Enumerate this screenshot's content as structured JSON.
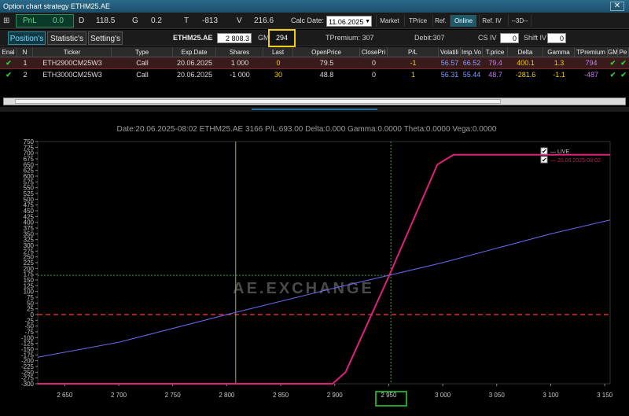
{
  "window": {
    "title": "Option chart strategy ETHM25.AE",
    "close_icon": "close-icon"
  },
  "stats": {
    "pnl_label": "PnL",
    "pnl_value": "0.0",
    "d_label": "D",
    "d_value": "118.5",
    "g_label": "G",
    "g_value": "0.2",
    "t_label": "T",
    "t_value": "-813",
    "v_label": "V",
    "v_value": "216.6"
  },
  "calc": {
    "label": "Calc Date:",
    "value": "11.06.2025"
  },
  "toolbar": {
    "market": "Market",
    "tprice": "TPrice",
    "ref": "Ref.",
    "online": "Online",
    "refiv": "Ref. IV",
    "view3d": "--3D--"
  },
  "tabs": [
    {
      "label": "Position's"
    },
    {
      "label": "Statistic's"
    },
    {
      "label": "Setting's"
    }
  ],
  "underlying": {
    "symbol": "ETHM25.AE",
    "price": "2 808.3",
    "gm_label": "GM",
    "gm_value": "294",
    "tpremium": "TPremium: 307",
    "debit": "Debit:307",
    "csiv_label": "CS IV",
    "csiv_value": "0",
    "shiftiv_label": "Shift IV",
    "shiftiv_value": "0"
  },
  "table": {
    "headers": [
      "Enal",
      "N",
      "Ticker",
      "Type",
      "Exp.Date",
      "Shares",
      "Last",
      "OpenPrice",
      "ClosePri",
      "P/L",
      "Volatili",
      "Imp.Vo",
      "T.price",
      "Delta",
      "Gamma",
      "TPremium",
      "GM",
      "Pe"
    ],
    "rows": [
      {
        "n": "1",
        "ticker": "ETH2900CM25W3",
        "type": "Call",
        "exp": "20.06.2025",
        "shares": "1 000",
        "last": "0",
        "open": "79.5",
        "close": "0",
        "pl": "-1",
        "vol": "56.57",
        "imp": "66.52",
        "tprice": "79.4",
        "delta": "400.1",
        "gamma": "1.3",
        "tpremium": "794"
      },
      {
        "n": "2",
        "ticker": "ETH3000CM25W3",
        "type": "Call",
        "exp": "20.06.2025",
        "shares": "-1 000",
        "last": "30",
        "open": "48.8",
        "close": "0",
        "pl": "1",
        "vol": "56.31",
        "imp": "55.44",
        "tprice": "48.7",
        "delta": "-281.6",
        "gamma": "-1.1",
        "tpremium": "-487"
      }
    ]
  },
  "chart_info": "Date:20.06.2025-08:02  ETHM25.AE 3166  P/L:693.00  Delta:0.000  Gamma:0.0000  Theta:0.0000  Vega:0.0000",
  "watermark": "AE.EXCHANGE",
  "chart_data": {
    "type": "line",
    "ylim": [
      -300,
      750
    ],
    "xlim": [
      2625,
      3155
    ],
    "y_ticks": [
      -300,
      -275,
      -250,
      -225,
      -200,
      -175,
      -150,
      -125,
      -100,
      -75,
      -50,
      -25,
      0,
      25,
      50,
      75,
      100,
      125,
      150,
      175,
      200,
      225,
      250,
      275,
      300,
      325,
      350,
      375,
      400,
      425,
      450,
      475,
      500,
      525,
      550,
      575,
      600,
      625,
      650,
      675,
      700,
      725,
      750
    ],
    "x_ticks": [
      {
        "v": 2650,
        "l": "2 650"
      },
      {
        "v": 2700,
        "l": "2 700"
      },
      {
        "v": 2750,
        "l": "2 750"
      },
      {
        "v": 2800,
        "l": "2 800"
      },
      {
        "v": 2850,
        "l": "2 850"
      },
      {
        "v": 2900,
        "l": "2 900"
      },
      {
        "v": 2950,
        "l": "2 950"
      },
      {
        "v": 3000,
        "l": "3 000"
      },
      {
        "v": 3050,
        "l": "3 050"
      },
      {
        "v": 3100,
        "l": "3 100"
      },
      {
        "v": 3150,
        "l": "3 150"
      }
    ],
    "legend": [
      {
        "name": "LIVE",
        "color": "#c8c8c8"
      },
      {
        "name": "20.06.2025-08:02",
        "color": "#c2185b"
      }
    ],
    "series": [
      {
        "name": "LIVE",
        "color": "#6a6af0",
        "x": [
          2625,
          2700,
          2800,
          2900,
          2950,
          3000,
          3100,
          3155
        ],
        "y": [
          -185,
          -120,
          0,
          115,
          170,
          225,
          350,
          410
        ]
      },
      {
        "name": "20.06.2025-08:02",
        "color": "#e0207a",
        "x": [
          2625,
          2898,
          2910,
          2950,
          2995,
          3010,
          3155
        ],
        "y": [
          -300,
          -300,
          -250,
          165,
          650,
          693,
          693
        ]
      }
    ],
    "ref_lines": {
      "zero": 0,
      "breakeven_y": 170,
      "vline_current": 2808.3,
      "vline_gm": 2952
    }
  }
}
